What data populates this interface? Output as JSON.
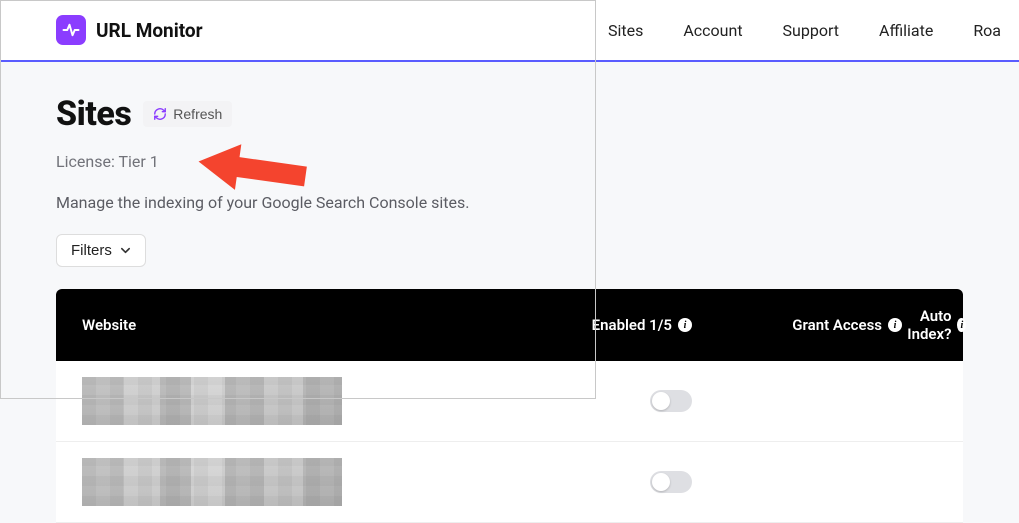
{
  "brand": {
    "name": "URL Monitor"
  },
  "nav": {
    "sites": "Sites",
    "account": "Account",
    "support": "Support",
    "affiliate": "Affiliate",
    "roadmap": "Roa"
  },
  "page": {
    "title": "Sites",
    "refresh_label": "Refresh",
    "license_text": "License: Tier 1",
    "description": "Manage the indexing of your Google Search Console sites.",
    "filters_label": "Filters"
  },
  "table": {
    "columns": {
      "website": "Website",
      "enabled": "Enabled 1/5",
      "grant": "Grant Access",
      "auto": "Auto Index?"
    }
  }
}
